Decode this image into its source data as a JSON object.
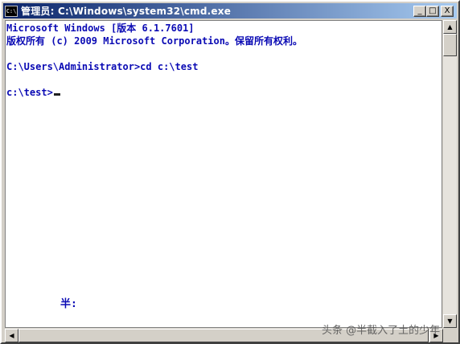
{
  "window": {
    "title": "管理员: C:\\Windows\\system32\\cmd.exe",
    "icon_label": "C:\\",
    "controls": {
      "minimize": "_",
      "maximize": "□",
      "close": "X"
    }
  },
  "console": {
    "lines": [
      "Microsoft Windows [版本 6.1.7601]",
      "版权所有 (c) 2009 Microsoft Corporation。保留所有权利。",
      "",
      "C:\\Users\\Administrator>cd c:\\test",
      "",
      "c:\\test>"
    ],
    "ime_status": "半:"
  },
  "scrollbars": {
    "up_arrow": "▲",
    "down_arrow": "▼",
    "left_arrow": "◀",
    "right_arrow": "▶"
  },
  "watermark": "头条 @半截入了土的少年",
  "colors": {
    "text": "#0a0ab4",
    "title_start": "#0a246a",
    "title_end": "#a6caf0"
  }
}
